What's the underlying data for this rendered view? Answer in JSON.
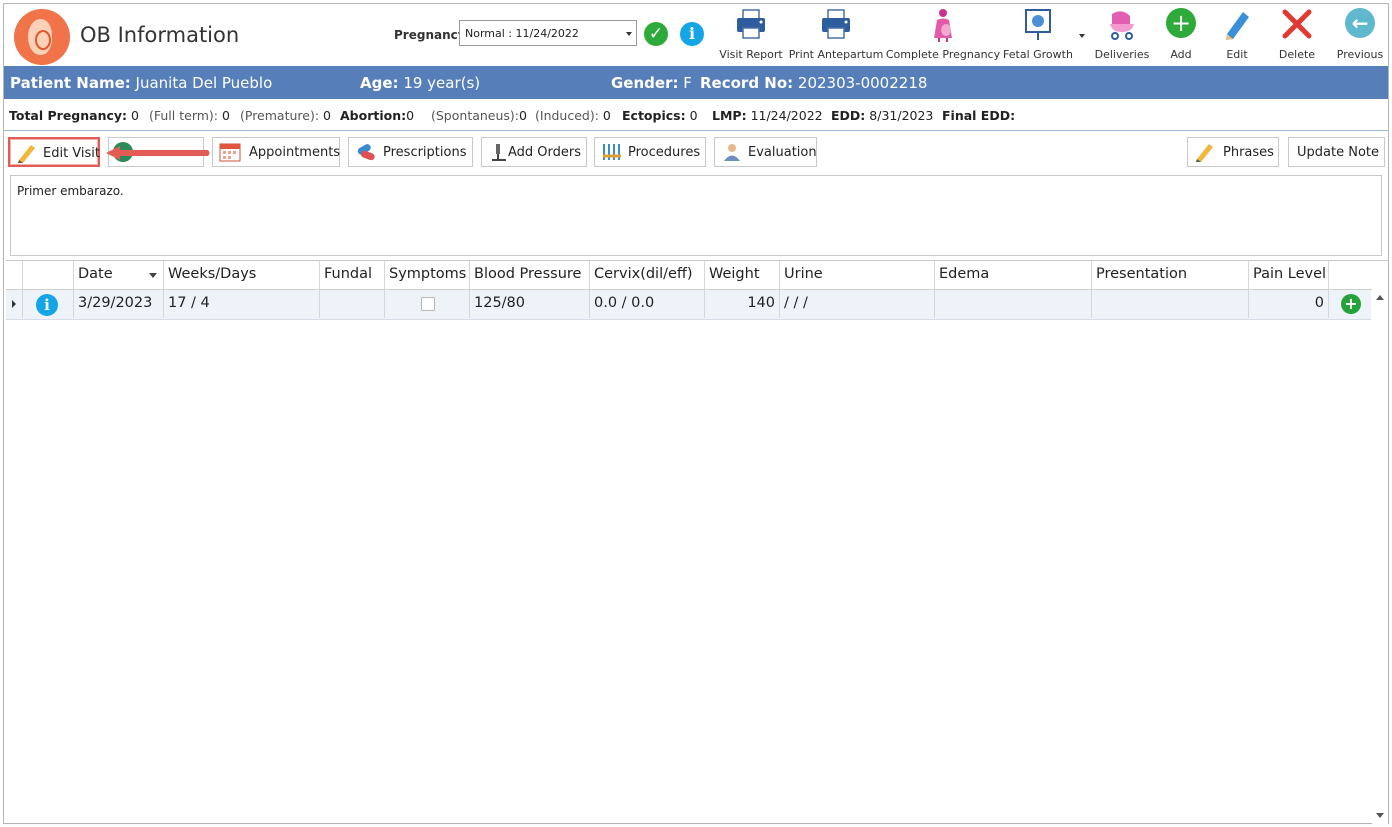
{
  "header": {
    "title": "OB Information",
    "pregnancy_label": "Pregnancy:",
    "pregnancy_value": "Normal : 11/24/2022"
  },
  "toolbar": [
    {
      "label": "Visit Report",
      "icon": "printer-icon"
    },
    {
      "label": "Print Antepartum",
      "icon": "printer-icon"
    },
    {
      "label": "Complete Pregnancy",
      "icon": "pregnant-woman-icon"
    },
    {
      "label": "Fetal Growth",
      "icon": "fetal-growth-chart-icon"
    },
    {
      "label": "Deliveries",
      "icon": "baby-stroller-icon"
    },
    {
      "label": "Add",
      "icon": "plus-circle-icon"
    },
    {
      "label": "Edit",
      "icon": "pencil-icon"
    },
    {
      "label": "Delete",
      "icon": "x-icon"
    },
    {
      "label": "Previous",
      "icon": "back-arrow-icon"
    }
  ],
  "patient": {
    "name_label": "Patient Name:",
    "name": "Juanita Del Pueblo",
    "age_label": "Age:",
    "age": "19 year(s)",
    "gender_label": "Gender:",
    "gender": "F",
    "record_label": "Record No:",
    "record": "202303-0002218"
  },
  "summary": {
    "total_pregnancy_label": "Total Pregnancy:",
    "total_pregnancy": "0",
    "full_term_label": "(Full term):",
    "full_term": "0",
    "premature_label": "(Premature):",
    "premature": "0",
    "abortion_label": "Abortion:",
    "abortion": "0",
    "spontaneus_label": "(Spontaneus):",
    "spontaneus": "0",
    "induced_label": "(Induced):",
    "induced": "0",
    "ectopics_label": "Ectopics:",
    "ectopics": "0",
    "lmp_label": "LMP:",
    "lmp": "11/24/2022",
    "edd_label": "EDD:",
    "edd": "8/31/2023",
    "final_edd_label": "Final EDD:",
    "final_edd": ""
  },
  "actions": {
    "edit_visit": "Edit Visit",
    "appointments": "Appointments",
    "prescriptions": "Prescriptions",
    "add_orders": "Add Orders",
    "procedures": "Procedures",
    "evaluation": "Evaluation",
    "phrases": "Phrases",
    "update_note": "Update Note"
  },
  "note": "Primer embarazo.",
  "grid": {
    "columns": [
      "Date",
      "Weeks/Days",
      "Fundal",
      "Symptoms",
      "Blood Pressure",
      "Cervix(dil/eff)",
      "Weight",
      "Urine",
      "Edema",
      "Presentation",
      "Pain Level"
    ],
    "rows": [
      {
        "date": "3/29/2023",
        "weeks_days": "17 / 4",
        "fundal": "",
        "symptoms": "",
        "blood_pressure": "125/80",
        "cervix": "0.0 / 0.0",
        "weight": "140",
        "urine": "/ / /",
        "edema": "",
        "presentation": "",
        "pain_level": "0"
      }
    ]
  },
  "colors": {
    "patient_bar": "#567fba",
    "highlight": "#e25c55",
    "accent_green": "#2eaa3a",
    "accent_blue": "#14a5e6"
  }
}
